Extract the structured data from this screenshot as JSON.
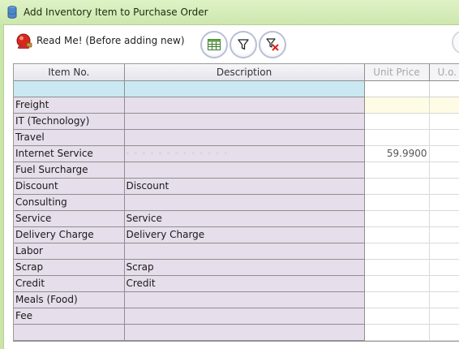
{
  "window": {
    "title": "Add Inventory Item to Purchase Order"
  },
  "toolbar": {
    "readme_label": "Read Me! (Before adding new)",
    "buttons": [
      "grid-view-icon",
      "filter-icon",
      "clear-filter-icon"
    ]
  },
  "grid": {
    "columns": [
      "Item No.",
      "Description",
      "Unit Price",
      "U.o."
    ],
    "rows": [
      {
        "item_no": "Freight",
        "description": "",
        "unit_price": ""
      },
      {
        "item_no": "IT (Technology)",
        "description": "",
        "unit_price": ""
      },
      {
        "item_no": "Travel",
        "description": "",
        "unit_price": ""
      },
      {
        "item_no": "Internet Service",
        "description": "-  -  -  -  -  -  -  -  -  -  -  -  -",
        "unit_price": "59.9900"
      },
      {
        "item_no": "Fuel Surcharge",
        "description": "",
        "unit_price": ""
      },
      {
        "item_no": "Discount",
        "description": "Discount",
        "unit_price": ""
      },
      {
        "item_no": "Consulting",
        "description": "",
        "unit_price": ""
      },
      {
        "item_no": "Service",
        "description": "Service",
        "unit_price": ""
      },
      {
        "item_no": "Delivery Charge",
        "description": "Delivery Charge",
        "unit_price": ""
      },
      {
        "item_no": "Labor",
        "description": "",
        "unit_price": ""
      },
      {
        "item_no": "Scrap",
        "description": "Scrap",
        "unit_price": ""
      },
      {
        "item_no": "Credit",
        "description": "Credit",
        "unit_price": ""
      },
      {
        "item_no": "Meals (Food)",
        "description": "",
        "unit_price": ""
      },
      {
        "item_no": "Fee",
        "description": "",
        "unit_price": ""
      },
      {
        "item_no": "",
        "description": "",
        "unit_price": ""
      }
    ]
  },
  "colors": {
    "frame": "#c9e6a8",
    "row_bg": "#e6deea",
    "filter_row": "#c9e8f2",
    "header_bg": "#eeecf2"
  }
}
